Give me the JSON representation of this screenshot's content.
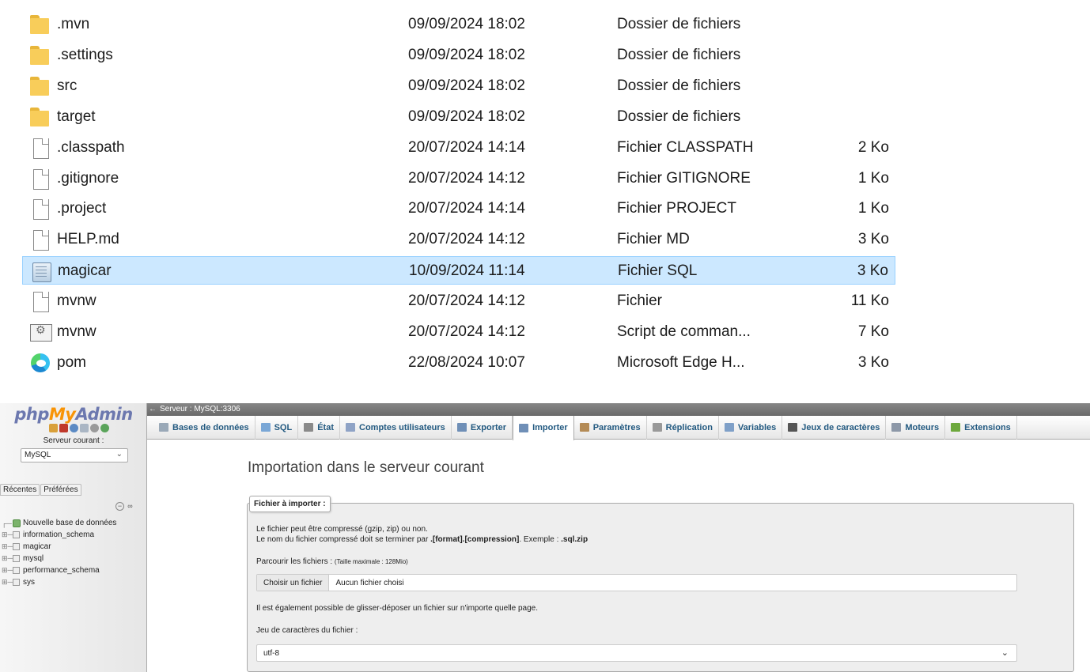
{
  "explorer": {
    "files": [
      {
        "icon": "folder-icon",
        "name": ".mvn",
        "date": "09/09/2024 18:02",
        "type": "Dossier de fichiers",
        "size": ""
      },
      {
        "icon": "folder-icon",
        "name": ".settings",
        "date": "09/09/2024 18:02",
        "type": "Dossier de fichiers",
        "size": ""
      },
      {
        "icon": "folder-icon",
        "name": "src",
        "date": "09/09/2024 18:02",
        "type": "Dossier de fichiers",
        "size": ""
      },
      {
        "icon": "folder-icon",
        "name": "target",
        "date": "09/09/2024 18:02",
        "type": "Dossier de fichiers",
        "size": ""
      },
      {
        "icon": "file-icon",
        "name": ".classpath",
        "date": "20/07/2024 14:14",
        "type": "Fichier CLASSPATH",
        "size": "2 Ko"
      },
      {
        "icon": "file-icon",
        "name": ".gitignore",
        "date": "20/07/2024 14:12",
        "type": "Fichier GITIGNORE",
        "size": "1 Ko"
      },
      {
        "icon": "file-icon",
        "name": ".project",
        "date": "20/07/2024 14:14",
        "type": "Fichier PROJECT",
        "size": "1 Ko"
      },
      {
        "icon": "file-icon",
        "name": "HELP.md",
        "date": "20/07/2024 14:12",
        "type": "Fichier MD",
        "size": "3 Ko"
      },
      {
        "icon": "sql-file-icon",
        "name": "magicar",
        "date": "10/09/2024 11:14",
        "type": "Fichier SQL",
        "size": "3 Ko",
        "selected": true
      },
      {
        "icon": "file-icon",
        "name": "mvnw",
        "date": "20/07/2024 14:12",
        "type": "Fichier",
        "size": "11 Ko"
      },
      {
        "icon": "script-file-icon",
        "name": "mvnw",
        "date": "20/07/2024 14:12",
        "type": "Script de comman...",
        "size": "7 Ko"
      },
      {
        "icon": "edge-icon",
        "name": "pom",
        "date": "22/08/2024 10:07",
        "type": "Microsoft Edge H...",
        "size": "3 Ko"
      }
    ]
  },
  "pma": {
    "logo_php": "php",
    "logo_my": "My",
    "logo_admin": "Admin",
    "server_label": "Serveur courant :",
    "server_select": "MySQL",
    "nav_tabs": [
      "Récentes",
      "Préférées"
    ],
    "new_db": "Nouvelle base de données",
    "databases": [
      "information_schema",
      "magicar",
      "mysql",
      "performance_schema",
      "sys"
    ],
    "breadcrumb": "Serveur : MySQL:3306",
    "menu": [
      {
        "label": "Bases de données",
        "icon": "database-icon",
        "color": "#9aa9b8"
      },
      {
        "label": "SQL",
        "icon": "sql-icon",
        "color": "#7aa7d6"
      },
      {
        "label": "État",
        "icon": "status-icon",
        "color": "#8a8a8a"
      },
      {
        "label": "Comptes utilisateurs",
        "icon": "users-icon",
        "color": "#8fa3c6"
      },
      {
        "label": "Exporter",
        "icon": "export-icon",
        "color": "#6f8fb7"
      },
      {
        "label": "Importer",
        "icon": "import-icon",
        "color": "#6f8fb7",
        "active": true
      },
      {
        "label": "Paramètres",
        "icon": "settings-icon",
        "color": "#b48b56"
      },
      {
        "label": "Réplication",
        "icon": "replication-icon",
        "color": "#999999"
      },
      {
        "label": "Variables",
        "icon": "variables-icon",
        "color": "#7fa0c8"
      },
      {
        "label": "Jeux de caractères",
        "icon": "charset-icon",
        "color": "#555555"
      },
      {
        "label": "Moteurs",
        "icon": "engines-icon",
        "color": "#8d98a8"
      },
      {
        "label": "Extensions",
        "icon": "extensions-icon",
        "color": "#6da83c"
      }
    ],
    "title": "Importation dans le serveur courant",
    "legend": "Fichier à importer :",
    "compress_line1": "Le fichier peut être compressé (gzip, zip) ou non.",
    "compress_line2_a": "Le nom du fichier compressé doit se terminer par ",
    "compress_line2_b": ".[format].[compression]",
    "compress_line2_c": ". Exemple : ",
    "compress_line2_d": ".sql.zip",
    "browse_label": "Parcourir les fichiers : ",
    "browse_max": "(Taille maximale : 128Mio)",
    "choose_button": "Choisir un fichier",
    "no_file": "Aucun fichier choisi",
    "dragdrop": "Il est également possible de glisser-déposer un fichier sur n'importe quelle page.",
    "charset_label": "Jeu de caractères du fichier :",
    "charset_value": "utf-8"
  }
}
